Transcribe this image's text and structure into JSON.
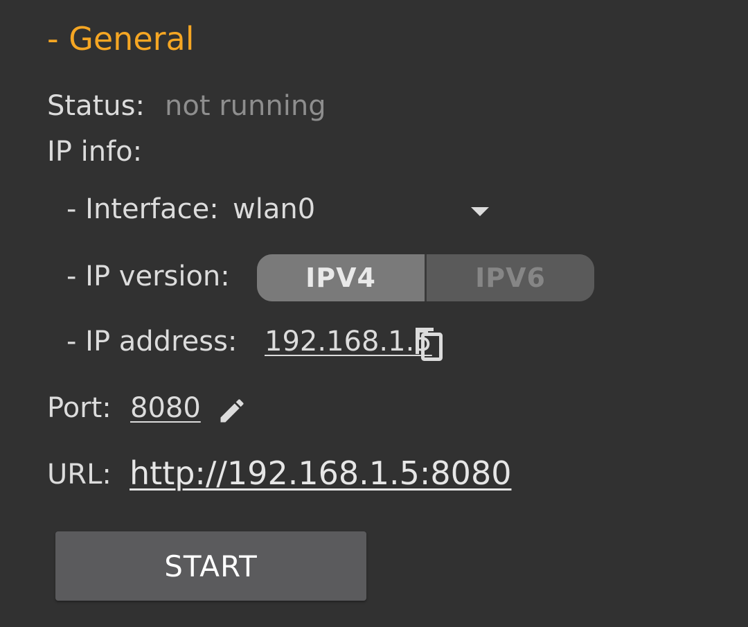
{
  "section": {
    "title": "- General"
  },
  "status": {
    "label": "Status:",
    "value": "not running"
  },
  "ip_info": {
    "label": "IP info:",
    "interface": {
      "label": "- Interface:",
      "value": "wlan0",
      "icon": "dropdown-arrow-icon"
    },
    "ip_version": {
      "label": "- IP version:",
      "options": [
        {
          "label": "IPV4",
          "selected": true
        },
        {
          "label": "IPV6",
          "selected": false
        }
      ]
    },
    "ip_address": {
      "label": "- IP address:",
      "value": "192.168.1.5",
      "icon": "copy-icon"
    }
  },
  "port": {
    "label": "Port:",
    "value": "8080",
    "icon": "edit-pencil-icon"
  },
  "url": {
    "label": "URL:",
    "value": "http://192.168.1.5:8080"
  },
  "start_button": {
    "label": "START"
  },
  "colors": {
    "background": "#313131",
    "accent": "#f5a623",
    "button": "#5b5b5d"
  }
}
